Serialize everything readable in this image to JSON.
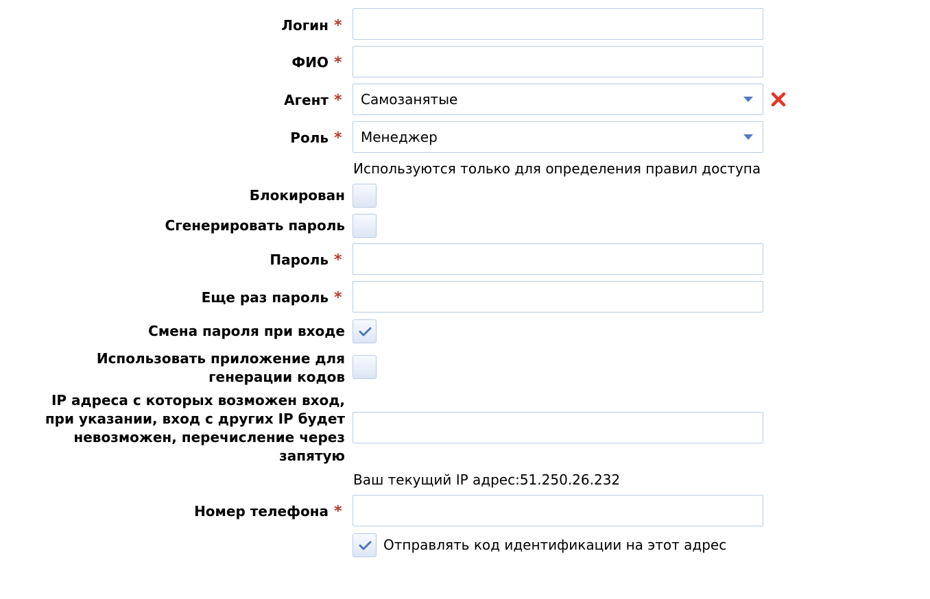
{
  "form": {
    "login": {
      "label": "Логин",
      "required_mark": "*",
      "value": ""
    },
    "fio": {
      "label": "ФИО",
      "required_mark": "*",
      "value": ""
    },
    "agent": {
      "label": "Агент",
      "required_mark": "*",
      "selected": "Самозанятые"
    },
    "role": {
      "label": "Роль",
      "required_mark": "*",
      "selected": "Менеджер",
      "hint": "Используются только для определения правил доступа"
    },
    "blocked": {
      "label": "Блокирован",
      "checked": false
    },
    "generate_password": {
      "label": "Сгенерировать пароль",
      "checked": false
    },
    "password": {
      "label": "Пароль",
      "required_mark": "*",
      "value": ""
    },
    "password_repeat": {
      "label": "Еще раз пароль",
      "required_mark": "*",
      "value": ""
    },
    "change_password_on_login": {
      "label": "Смена пароля при входе",
      "checked": true
    },
    "use_code_app": {
      "label_line1": "Использовать приложение для",
      "label_line2": "генерации кодов",
      "checked": false
    },
    "ip_addresses": {
      "label_line1": "IP адреса с которых возможен вход,",
      "label_line2": "при указании, вход с других IP будет",
      "label_line3": "невозможен, перечисление через",
      "label_line4": "запятую",
      "value": "",
      "current_ip_text": "Ваш текущий IP адрес:51.250.26.232"
    },
    "phone": {
      "label": "Номер телефона",
      "required_mark": "*",
      "value": ""
    },
    "send_code": {
      "label": "Отправлять код идентификации на этот адрес",
      "checked": true
    }
  },
  "colors": {
    "required_star": "#c0392b",
    "input_border": "#b8cce4",
    "dropdown_arrow": "#4f7dbf",
    "clear_icon": "#e53322",
    "checkmark": "#4a78b4"
  },
  "icons": {
    "dropdown": "triangle-down",
    "clear": "red-x",
    "check": "checkmark"
  }
}
